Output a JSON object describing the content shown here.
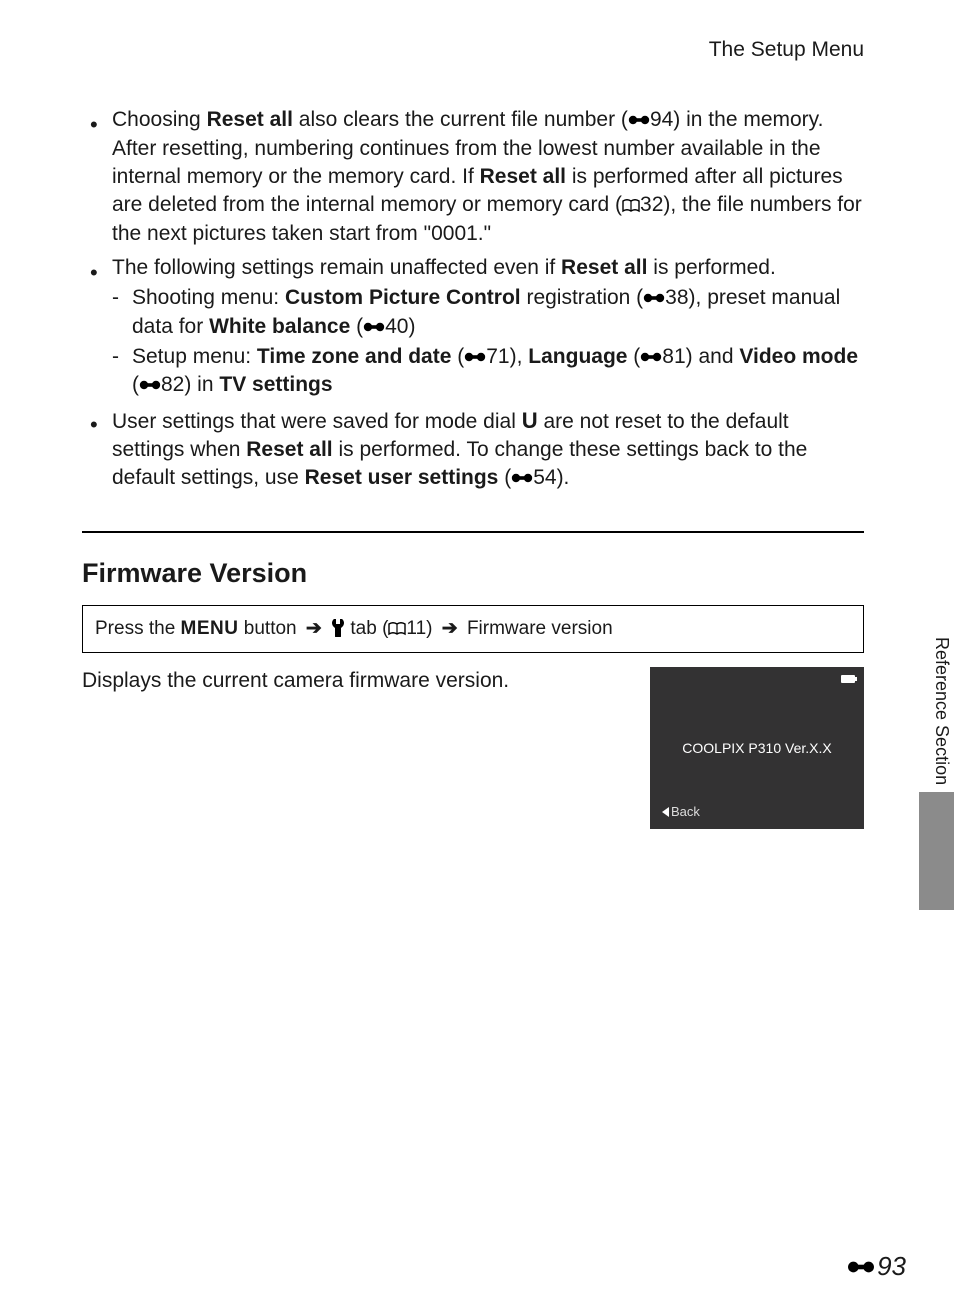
{
  "header": {
    "title": "The Setup Menu"
  },
  "bullets": {
    "b1": {
      "t1": "Choosing ",
      "bold1": "Reset all",
      "t2": " also clears the current file number (",
      "ref1": "94",
      "t3": ") in the memory. After resetting, numbering continues from the lowest number available in the internal memory or the memory card. If ",
      "bold2": "Reset all",
      "t4": " is performed after all pictures are deleted from the internal memory or memory card (",
      "book1": "32",
      "t5": "), the file numbers for the next pictures taken start from \"0001.\""
    },
    "b2": {
      "t1": "The following settings remain unaffected even if ",
      "bold1": "Reset all",
      "t2": " is performed.",
      "d1": {
        "t1": "Shooting menu: ",
        "bold1": "Custom Picture Control",
        "t2": " registration (",
        "ref1": "38",
        "t3": "), preset manual data for ",
        "bold2": "White balance",
        "t4": " (",
        "ref2": "40",
        "t5": ")"
      },
      "d2": {
        "t1": " Setup menu: ",
        "bold1": "Time zone and date",
        "t2": " (",
        "ref1": "71",
        "t3": "), ",
        "bold2": "Language",
        "t4": " (",
        "ref2": "81",
        "t5": ") and ",
        "bold3": "Video mode",
        "t6": " (",
        "ref3": "82",
        "t7": ") in ",
        "bold4": "TV settings"
      }
    },
    "b3": {
      "t1": "User settings that were saved for mode dial ",
      "u": "U",
      "t2": " are not reset to the default settings when ",
      "bold1": "Reset all",
      "t3": " is performed. To change these settings back to the default settings, use ",
      "bold2": "Reset user settings",
      "t4": " (",
      "ref1": "54",
      "t5": ")."
    }
  },
  "section": {
    "title": "Firmware Version"
  },
  "path": {
    "p1": "Press the ",
    "menu": "MENU",
    "p2": " button ",
    "p3": " tab (",
    "book": "11",
    "p4": ") ",
    "p5": " Firmware version"
  },
  "firmware": {
    "desc": "Displays the current camera firmware version.",
    "model": "COOLPIX P310 Ver.X.X",
    "back": "Back"
  },
  "side": {
    "label": "Reference Section"
  },
  "pagenum": "93"
}
